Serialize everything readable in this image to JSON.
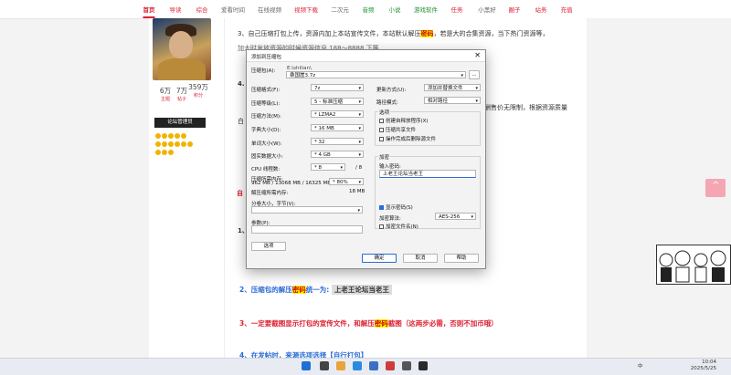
{
  "nav": {
    "items": [
      {
        "label": "首页",
        "active": true
      },
      {
        "label": "导读",
        "color": "#d23"
      },
      {
        "label": "综合",
        "color": "#d23"
      },
      {
        "label": "爱看时间",
        "color": "#666"
      },
      {
        "label": "在线视频",
        "color": "#666"
      },
      {
        "label": "视频下载",
        "color": "#d23"
      },
      {
        "label": "二次元",
        "color": "#666"
      },
      {
        "label": "音频",
        "color": "#1a8f2f"
      },
      {
        "label": "小说",
        "color": "#1a8f2f"
      },
      {
        "label": "游戏软件",
        "color": "#1a8f2f"
      },
      {
        "label": "任务",
        "color": "#d23"
      },
      {
        "label": "小黑好",
        "color": "#666"
      },
      {
        "label": "圈子",
        "color": "#d23"
      },
      {
        "label": "站务",
        "color": "#d23"
      },
      {
        "label": "充值",
        "color": "#d23"
      }
    ]
  },
  "profile": {
    "stats": [
      {
        "num": "6万",
        "label": "主题"
      },
      {
        "num": "7万",
        "label": "帖子"
      },
      {
        "num": "359万",
        "label": "积分"
      }
    ],
    "badge": "论坛管理员"
  },
  "article": {
    "p3_line1": "3、自己压缩打包上传，资源内加上本站宣传文件，本站默认解压",
    "p3_pw": "密码",
    "p3_line1_tail": "，若是大的合集资源，当下热门资源等，",
    "p3_line2": "加大时发放资源的时候资源信息 188～8888 下等",
    "right_partial1": "酬售价无限制，根据资源质量",
    "left_partial_4": "4.",
    "left_partial_bai": "白",
    "left_num1": "1、",
    "left_num3": "3、",
    "left_red": "自",
    "step2_prefix": "2、压缩包的解压",
    "step2_pw": "密码",
    "step2_mid": "统一为:",
    "step2_value": "上老王论坛当老王",
    "step3_a": "3、一定要截图显示打包的宣传文件，和解压",
    "step3_pw": "密码",
    "step3_b": "截图（这两步必需，否则不加币哦）",
    "step4": "4、在发帖时，来源选项选择【自行打包】"
  },
  "dialog": {
    "title": "添加到压缩包",
    "close": "✕",
    "archive_label": "压缩包(A):",
    "archive_path": "E:\\shilian\\",
    "archive_name": "桑国崖3.7z",
    "browse": "...",
    "format_label": "压缩格式(F):",
    "format_value": "7z",
    "level_label": "压缩等级(L):",
    "level_value": "5 - 标准压缩",
    "method_label": "压缩方法(M):",
    "method_value": "* LZMA2",
    "dict_label": "字典大小(D):",
    "dict_value": "* 16 MB",
    "word_label": "单词大小(W):",
    "word_value": "* 32",
    "solid_label": "固实数据大小:",
    "solid_value": "* 4 GB",
    "cpu_label": "CPU 线程数:",
    "cpu_value": "* 8",
    "cpu_max": "/ 8",
    "mem_label": "压缩所需内存:",
    "mem_detail": "962 MB / 13068 MB / 16325 MB",
    "mem_pct": "* 80%",
    "decomp_label": "解压缩所需内存:",
    "decomp_value": "18 MB",
    "split_label": "分卷大小，字节(V):",
    "params_label": "参数(P):",
    "options_btn": "选项",
    "update_label": "更新方式(U):",
    "update_value": "添加并替换文件",
    "path_label": "路径模式:",
    "path_value": "相对路径",
    "options_group": "选项",
    "opt_sfx": "创建自释放程序(X)",
    "opt_shared": "压缩共享文件",
    "opt_delete": "操作完成后删除源文件",
    "encrypt_group": "加密",
    "pw_label": "输入密码:",
    "pw_value": "上老王论坛当老王",
    "show_pw": "显示密码(S)",
    "enc_method_label": "加密算法:",
    "enc_method_value": "AES-256",
    "enc_names": "加密文件名(N)",
    "ok": "确定",
    "cancel": "取消",
    "help": "帮助"
  },
  "taskbar": {
    "time": "10:04",
    "date": "2025/5/25",
    "ime": "中"
  }
}
